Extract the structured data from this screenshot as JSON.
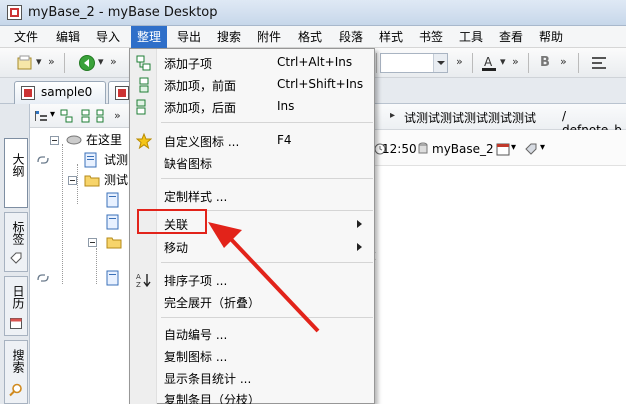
{
  "window": {
    "title": "myBase_2 - myBase Desktop"
  },
  "menubar": {
    "items": [
      "文件",
      "编辑",
      "导入",
      "整理",
      "导出",
      "搜索",
      "附件",
      "格式",
      "段落",
      "样式",
      "书签",
      "工具",
      "查看",
      "帮助"
    ],
    "active": "整理"
  },
  "toolbar": {
    "chevron": "»",
    "bold_label": "B"
  },
  "tabs": {
    "doc_tab_label": "sample0"
  },
  "vertical_tabs": [
    "大纲",
    "标签",
    "日历",
    "搜索"
  ],
  "tree": {
    "rows": [
      "在这里",
      "试测",
      "测试"
    ]
  },
  "breadcrumb": {
    "separator": "▸",
    "path_text": "试测试测试测试测试测试",
    "trailing": "/ defnote_b"
  },
  "infobar": {
    "time": "12:50",
    "db_name": "myBase_2"
  },
  "content": {
    "partial_char": "t"
  },
  "popup_menu": {
    "items": [
      {
        "label": "添加子项",
        "shortcut": "Ctrl+Alt+Ins",
        "icon": "add-child-icon"
      },
      {
        "label": "添加项，前面",
        "shortcut": "Ctrl+Shift+Ins",
        "icon": "add-before-icon"
      },
      {
        "label": "添加项，后面",
        "shortcut": "Ins",
        "icon": "add-after-icon"
      },
      {
        "label": "自定义图标 ...",
        "shortcut": "F4",
        "icon": "star-icon"
      },
      {
        "label": "缺省图标",
        "shortcut": "",
        "icon": ""
      },
      {
        "label": "定制样式 ...",
        "shortcut": "",
        "icon": ""
      },
      {
        "label": "关联",
        "shortcut": "",
        "icon": "",
        "submenu": true
      },
      {
        "label": "移动",
        "shortcut": "",
        "icon": "",
        "submenu": true
      },
      {
        "label": "排序子项 ...",
        "shortcut": "",
        "icon": "sort-az-icon"
      },
      {
        "label": "完全展开（折叠）",
        "shortcut": "",
        "icon": ""
      },
      {
        "label": "自动编号 ...",
        "shortcut": "",
        "icon": ""
      },
      {
        "label": "复制图标 ...",
        "shortcut": "",
        "icon": ""
      },
      {
        "label": "显示条目统计 ...",
        "shortcut": "",
        "icon": ""
      },
      {
        "label": "复制条目（分枝）",
        "shortcut": "",
        "icon": ""
      }
    ]
  },
  "annotation": {
    "color": "#e2231a",
    "target": "关联"
  }
}
